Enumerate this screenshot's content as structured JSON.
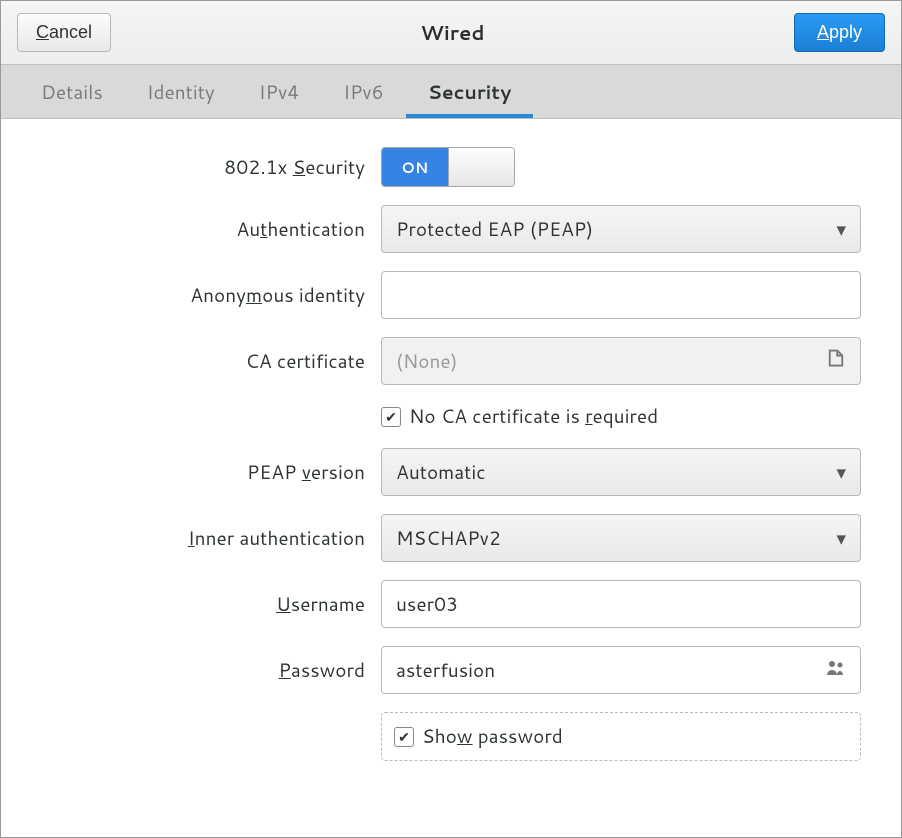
{
  "header": {
    "cancel": "Cancel",
    "title": "Wired",
    "apply": "Apply"
  },
  "tabs": [
    "Details",
    "Identity",
    "IPv4",
    "IPv6",
    "Security"
  ],
  "active_tab": "Security",
  "security": {
    "toggle_label": "802.1x Security",
    "toggle_state": "ON",
    "authentication_label": "Authentication",
    "authentication_value": "Protected EAP (PEAP)",
    "anon_identity_label": "Anonymous identity",
    "anon_identity_value": "",
    "ca_cert_label": "CA certificate",
    "ca_cert_value": "(None)",
    "no_ca_required_label": "No CA certificate is required",
    "no_ca_required_checked": true,
    "peap_version_label": "PEAP version",
    "peap_version_value": "Automatic",
    "inner_auth_label": "Inner authentication",
    "inner_auth_value": "MSCHAPv2",
    "username_label": "Username",
    "username_value": "user03",
    "password_label": "Password",
    "password_value": "asterfusion",
    "show_password_label": "Show password",
    "show_password_checked": true
  }
}
